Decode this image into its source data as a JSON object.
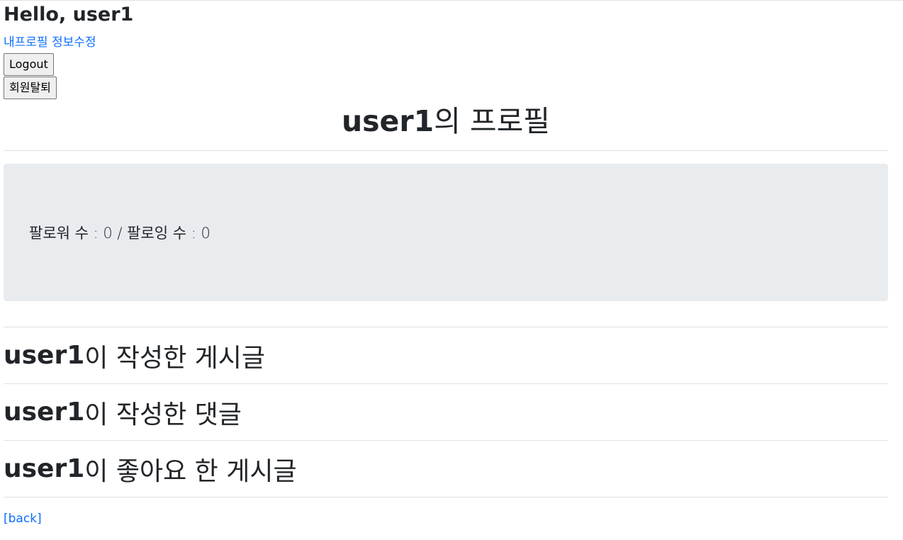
{
  "header": {
    "greeting": "Hello, user1",
    "edit_profile_link": "내프로필 정보수정",
    "logout_button": "Logout",
    "withdraw_button": "회원탈퇴"
  },
  "profile": {
    "username": "user1",
    "title_suffix": "의 프로필",
    "follow_stats": "팔로워 수 : 0 / 팔로잉 수 : 0"
  },
  "sections": [
    {
      "username": "user1",
      "label": "이 작성한 게시글"
    },
    {
      "username": "user1",
      "label": "이 작성한 댓글"
    },
    {
      "username": "user1",
      "label": "이 좋아요 한 게시글"
    }
  ],
  "footer": {
    "back_link": "[back]"
  }
}
